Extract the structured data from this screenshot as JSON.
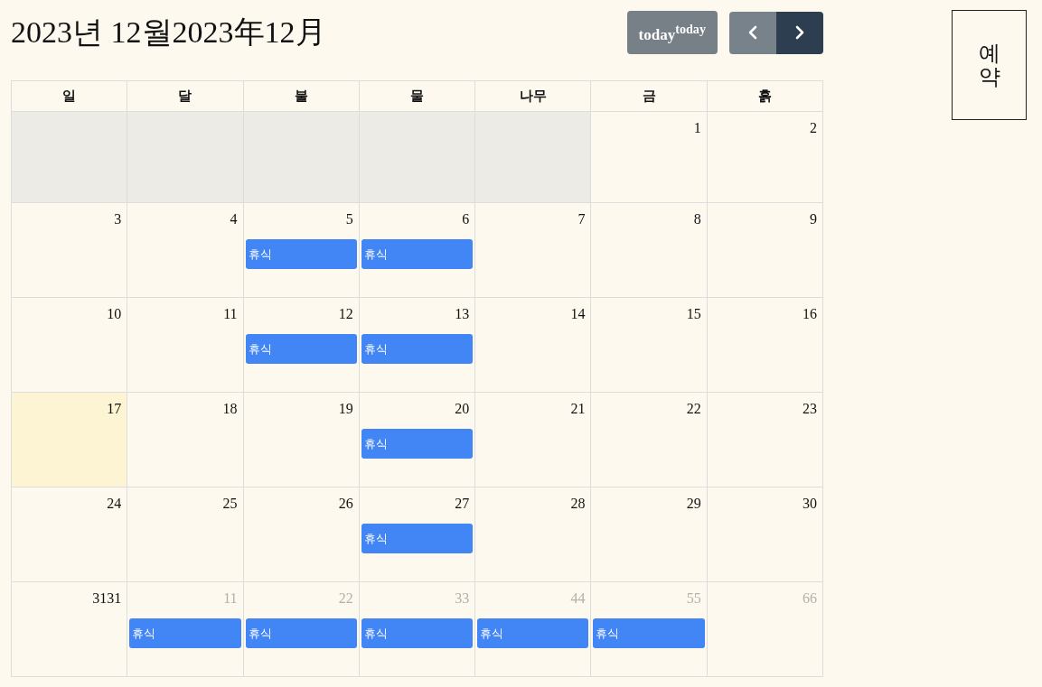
{
  "header": {
    "title": "2023년 12월2023年12月"
  },
  "toolbar": {
    "today_button": {
      "label": "today$^{today}$",
      "disabled": true
    },
    "nav_buttons": [
      {
        "kind": "prev",
        "disabled": true
      },
      {
        "kind": "next",
        "disabled": false
      }
    ]
  },
  "reserve_button": {
    "label": "예약"
  },
  "calendar": {
    "weekdays": [
      "일",
      "달",
      "불",
      "물",
      "나무",
      "금",
      "흙"
    ],
    "weeks": [
      {
        "days": [
          {
            "kind": "blank",
            "today": false
          },
          {
            "kind": "blank",
            "today": false
          },
          {
            "kind": "blank",
            "today": false
          },
          {
            "kind": "blank",
            "today": false
          },
          {
            "kind": "blank",
            "today": false
          },
          {
            "kind": "day",
            "day": "1",
            "today": false
          },
          {
            "kind": "day",
            "day": "2",
            "today": false
          }
        ]
      },
      {
        "days": [
          {
            "kind": "day",
            "day": "3",
            "today": false
          },
          {
            "kind": "day",
            "day": "4",
            "today": false
          },
          {
            "kind": "day",
            "day": "5",
            "today": false,
            "events": [
              {
                "title": "휴식"
              }
            ]
          },
          {
            "kind": "day",
            "day": "6",
            "today": false,
            "events": [
              {
                "title": "휴식"
              }
            ]
          },
          {
            "kind": "day",
            "day": "7",
            "today": false
          },
          {
            "kind": "day",
            "day": "8",
            "today": false
          },
          {
            "kind": "day",
            "day": "9",
            "today": false
          }
        ]
      },
      {
        "days": [
          {
            "kind": "day",
            "day": "10",
            "today": false
          },
          {
            "kind": "day",
            "day": "11",
            "today": false
          },
          {
            "kind": "day",
            "day": "12",
            "today": false,
            "events": [
              {
                "title": "휴식"
              }
            ]
          },
          {
            "kind": "day",
            "day": "13",
            "today": false,
            "events": [
              {
                "title": "휴식"
              }
            ]
          },
          {
            "kind": "day",
            "day": "14",
            "today": false
          },
          {
            "kind": "day",
            "day": "15",
            "today": false
          },
          {
            "kind": "day",
            "day": "16",
            "today": false
          }
        ]
      },
      {
        "days": [
          {
            "kind": "day",
            "day": "17",
            "today": true
          },
          {
            "kind": "day",
            "day": "18",
            "today": false
          },
          {
            "kind": "day",
            "day": "19",
            "today": false
          },
          {
            "kind": "day",
            "day": "20",
            "today": false,
            "events": [
              {
                "title": "휴식"
              }
            ]
          },
          {
            "kind": "day",
            "day": "21",
            "today": false
          },
          {
            "kind": "day",
            "day": "22",
            "today": false
          },
          {
            "kind": "day",
            "day": "23",
            "today": false
          }
        ]
      },
      {
        "days": [
          {
            "kind": "day",
            "day": "24",
            "today": false
          },
          {
            "kind": "day",
            "day": "25",
            "today": false
          },
          {
            "kind": "day",
            "day": "26",
            "today": false
          },
          {
            "kind": "day",
            "day": "27",
            "today": false,
            "events": [
              {
                "title": "휴식"
              }
            ]
          },
          {
            "kind": "day",
            "day": "28",
            "today": false
          },
          {
            "kind": "day",
            "day": "29",
            "today": false
          },
          {
            "kind": "day",
            "day": "30",
            "today": false
          }
        ]
      },
      {
        "days": [
          {
            "kind": "day",
            "day": "3131",
            "today": false
          },
          {
            "kind": "next_month",
            "day": "11",
            "today": false,
            "events": [
              {
                "title": "휴식"
              }
            ]
          },
          {
            "kind": "next_month",
            "day": "22",
            "today": false,
            "events": [
              {
                "title": "휴식"
              }
            ]
          },
          {
            "kind": "next_month",
            "day": "33",
            "today": false,
            "events": [
              {
                "title": "휴식"
              }
            ]
          },
          {
            "kind": "next_month",
            "day": "44",
            "today": false,
            "events": [
              {
                "title": "휴식"
              }
            ]
          },
          {
            "kind": "next_month",
            "day": "55",
            "today": false,
            "events": [
              {
                "title": "휴식"
              }
            ]
          },
          {
            "kind": "next_month",
            "day": "66",
            "today": false
          }
        ]
      }
    ]
  }
}
